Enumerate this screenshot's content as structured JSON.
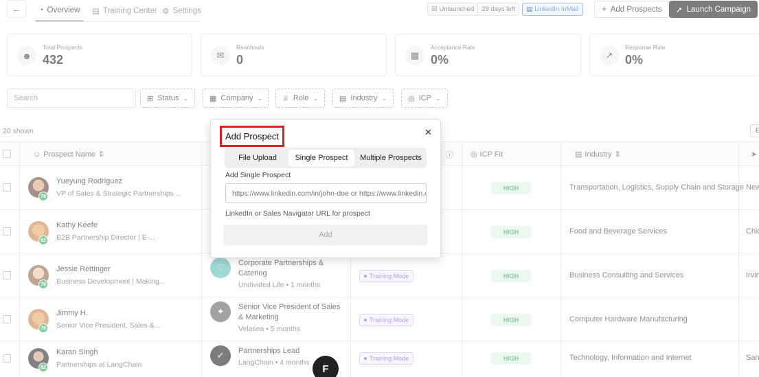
{
  "topbar": {
    "back_icon": "arrow-left-icon",
    "tabs": [
      {
        "label": "Overview",
        "icon": "pie-chart-icon"
      },
      {
        "label": "Training Center",
        "icon": "book-icon"
      },
      {
        "label": "Settings",
        "icon": "gear-icon"
      }
    ],
    "status_pill": {
      "status": "Unlaunched",
      "days_left": "29 days left"
    },
    "inmail_label": "LinkedIn InMail",
    "add_prospects_label": "Add Prospects",
    "launch_campaign_label": "Launch Campaign"
  },
  "stats": [
    {
      "label": "Total Prospects",
      "value": "432",
      "icon": "users-icon"
    },
    {
      "label": "Reachouts",
      "value": "0",
      "icon": "mail-icon"
    },
    {
      "label": "Acceptance Rate",
      "value": "0%",
      "icon": "bar-chart-icon"
    },
    {
      "label": "Response Rate",
      "value": "0%",
      "icon": "line-chart-icon"
    }
  ],
  "filters": {
    "search_placeholder": "Search",
    "items": [
      {
        "label": "Status",
        "icon": "status-icon"
      },
      {
        "label": "Company",
        "icon": "building-icon"
      },
      {
        "label": "Role",
        "icon": "crown-icon"
      },
      {
        "label": "Industry",
        "icon": "factory-icon"
      },
      {
        "label": "ICP",
        "icon": "target-icon"
      }
    ]
  },
  "table": {
    "shown_label": "20 shown",
    "right_button_letter": "E",
    "headers": {
      "prospect_name": "Prospect Name",
      "icp_fit": "ICP Fit",
      "industry": "Industry"
    },
    "rows": [
      {
        "name": "Yueyung Rodriguez",
        "title": "VP of Sales & Strategic Partnerships ...",
        "score": "78",
        "icp": "HIGH",
        "industry": "Transportation, Logistics, Supply Chain and Storage",
        "location": "New"
      },
      {
        "name": "Kathy Keefe",
        "title": "B2B Partnership Director | E-...",
        "score": "82",
        "icp": "HIGH",
        "industry": "Food and Beverage Services",
        "location": "Chic"
      },
      {
        "name": "Jessie Rettinger",
        "title": "Business Development | Making...",
        "score": "78",
        "role": "Corporate Partnerships & Catering",
        "company_meta": "Undivided Life • 1 months",
        "mode": "Training Mode",
        "icp": "HIGH",
        "industry": "Business Consulting and Services",
        "location": "Irvin"
      },
      {
        "name": "Jimmy H.",
        "title": "Senior Vice President, Sales &...",
        "score": "78",
        "role": "Senior Vice President of Sales & Marketing",
        "company_meta": "Velasea • 5 months",
        "mode": "Training Mode",
        "icp": "HIGH",
        "industry": "Computer Hardware Manufacturing",
        "location": ""
      },
      {
        "name": "Karan Singh",
        "title": "Partnerships at LangChain",
        "score": "82",
        "role": "Partnerships Lead",
        "company_meta": "LangChain • 4 months",
        "mode": "Training Mode",
        "icp": "HIGH",
        "industry": "Technology, Information and Internet",
        "location": "San"
      }
    ]
  },
  "modal": {
    "title": "Add Prospect",
    "close_icon": "close-icon",
    "tabs": [
      "File Upload",
      "Single Prospect",
      "Multiple Prospects"
    ],
    "field_label": "Add Single Prospect",
    "field_placeholder": "https://www.linkedin.com/in/john-doe or https://www.linkedin.com/sales/lead/...",
    "help_text": "LinkedIn or Sales Navigator URL for prospect",
    "add_label": "Add"
  },
  "fab_letter": "F"
}
